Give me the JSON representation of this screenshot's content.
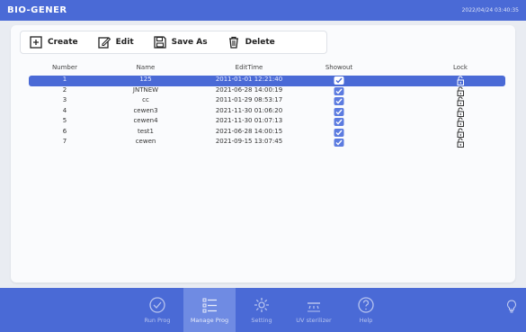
{
  "app": {
    "title": "BIO-GENER",
    "clock": "2022/04/24 03:40:35"
  },
  "toolbar": {
    "create_label": "Create",
    "edit_label": "Edit",
    "save_as_label": "Save As",
    "delete_label": "Delete"
  },
  "table": {
    "headers": {
      "number": "Number",
      "name": "Name",
      "edit_time": "EditTime",
      "showout": "Showout",
      "lock": "Lock"
    },
    "rows": [
      {
        "number": "1",
        "name": "125",
        "edit_time": "2011-01-01 12:21:40",
        "showout": true,
        "locked": false,
        "selected": true
      },
      {
        "number": "2",
        "name": "JNTNEW",
        "edit_time": "2021-06-28 14:00:19",
        "showout": true,
        "locked": false,
        "selected": false
      },
      {
        "number": "3",
        "name": "cc",
        "edit_time": "2011-01-29 08:53:17",
        "showout": true,
        "locked": false,
        "selected": false
      },
      {
        "number": "4",
        "name": "cewen3",
        "edit_time": "2021-11-30 01:06:20",
        "showout": true,
        "locked": false,
        "selected": false
      },
      {
        "number": "5",
        "name": "cewen4",
        "edit_time": "2021-11-30 01:07:13",
        "showout": true,
        "locked": false,
        "selected": false
      },
      {
        "number": "6",
        "name": "test1",
        "edit_time": "2021-06-28 14:00:15",
        "showout": true,
        "locked": false,
        "selected": false
      },
      {
        "number": "7",
        "name": "cewen",
        "edit_time": "2021-09-15 13:07:45",
        "showout": true,
        "locked": false,
        "selected": false
      }
    ]
  },
  "nav": {
    "items": [
      {
        "label": "Run Prog",
        "icon": "run-check-icon",
        "active": false
      },
      {
        "label": "Manage Prog",
        "icon": "list-icon",
        "active": true
      },
      {
        "label": "Setting",
        "icon": "gear-icon",
        "active": false
      },
      {
        "label": "UV sterilizer",
        "icon": "uv-lamp-icon",
        "active": false
      },
      {
        "label": "Help",
        "icon": "help-icon",
        "active": false
      }
    ]
  },
  "colors": {
    "accent": "#4a6ad6",
    "active_nav": "#6f8be3",
    "panel": "#fafbfd"
  }
}
